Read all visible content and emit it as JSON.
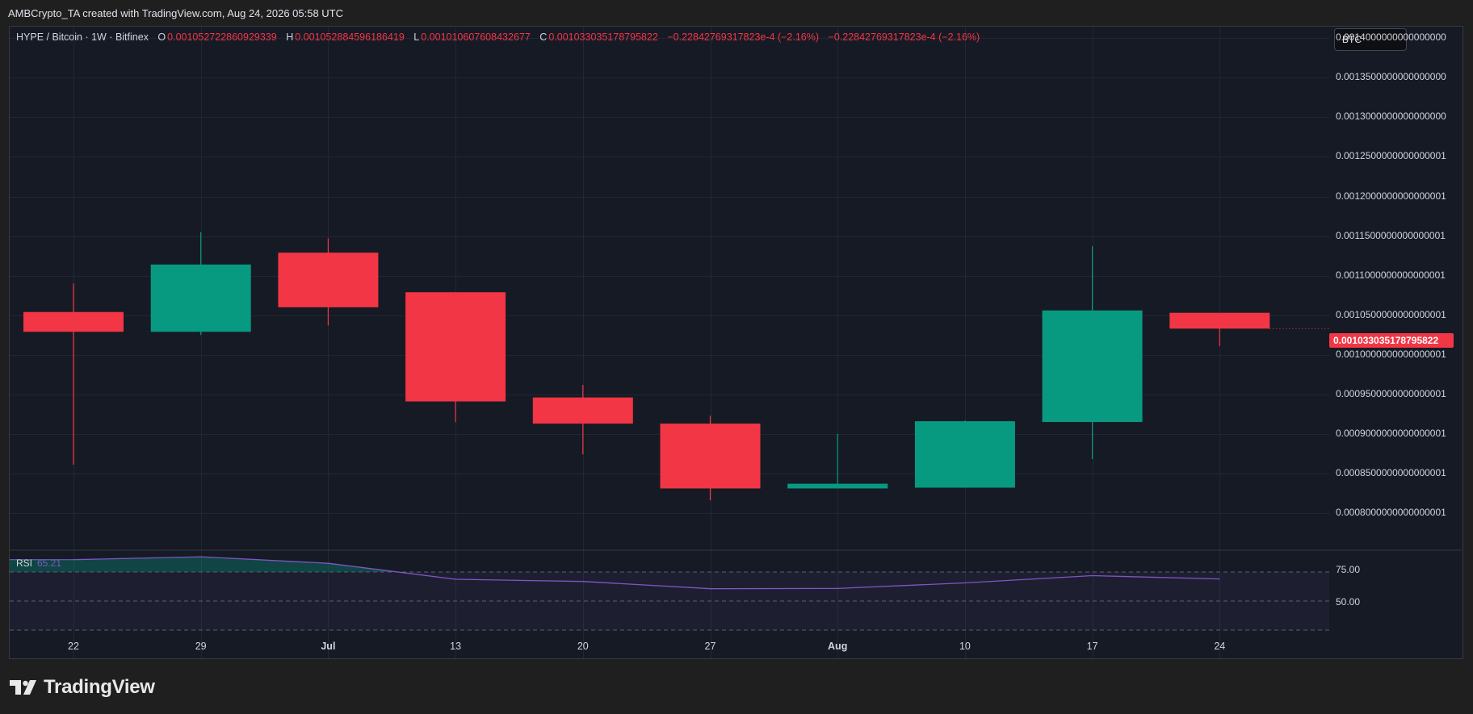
{
  "header": {
    "attribution": "AMBCrypto_TA created with TradingView.com, Aug 24, 2026 05:58 UTC"
  },
  "legend": {
    "symbol": "HYPE / Bitcoin · 1W · Bitfinex",
    "o_key": "O",
    "o_val": "0.001052722860929339",
    "h_key": "H",
    "h_val": "0.001052884596186419",
    "l_key": "L",
    "l_val": "0.001010607608432677",
    "c_key": "C",
    "c_val": "0.001033035178795822",
    "change1": "−0.22842769317823e-4 (−2.16%)",
    "change2": "−0.22842769317823e-4 (−2.16%)"
  },
  "currency_badge": "BTC",
  "last_price_tag": "0.001033035178795822",
  "rsi": {
    "label": "RSI",
    "value": "65.21",
    "ticks": [
      "75.00",
      "50.00"
    ]
  },
  "brand": "TradingView",
  "colors": {
    "up": "#089981",
    "down": "#f23645",
    "rsi": "#7e57c2",
    "background": "#161a25"
  },
  "chart_data": {
    "type": "candlestick",
    "title": "HYPE / Bitcoin · 1W · Bitfinex",
    "price_axis_labels": [
      "0.0014000000000000000",
      "0.0013500000000000000",
      "0.0013000000000000000",
      "0.0012500000000000001",
      "0.0012000000000000001",
      "0.0011500000000000001",
      "0.0011000000000000001",
      "0.0010500000000000001",
      "0.0010000000000000001",
      "0.0009500000000000001",
      "0.0009000000000000001",
      "0.0008500000000000001",
      "0.0008000000000000001"
    ],
    "price_axis_values": [
      0.0014,
      0.00135,
      0.0013,
      0.00125,
      0.0012,
      0.00115,
      0.0011,
      0.00105,
      0.001,
      0.00095,
      0.0009,
      0.00085,
      0.0008
    ],
    "ylim": [
      0.000755,
      0.0014075
    ],
    "x_labels": [
      "22",
      "29",
      "Jul",
      "13",
      "20",
      "27",
      "Aug",
      "10",
      "17",
      "24"
    ],
    "x_labels_bold": [
      "Jul",
      "Aug"
    ],
    "candles": [
      {
        "date": "22",
        "open": 0.001054,
        "high": 0.00109,
        "low": 0.000861,
        "close": 0.001029
      },
      {
        "date": "29",
        "open": 0.001029,
        "high": 0.001155,
        "low": 0.001025,
        "close": 0.001114
      },
      {
        "date": "Jul",
        "open": 0.001129,
        "high": 0.001147,
        "low": 0.001037,
        "close": 0.00106
      },
      {
        "date": "13",
        "open": 0.001079,
        "high": 0.001079,
        "low": 0.000915,
        "close": 0.000941
      },
      {
        "date": "20",
        "open": 0.000946,
        "high": 0.000962,
        "low": 0.000874,
        "close": 0.000913
      },
      {
        "date": "27",
        "open": 0.000913,
        "high": 0.000923,
        "low": 0.000816,
        "close": 0.000831
      },
      {
        "date": "Aug",
        "open": 0.000831,
        "high": 0.0009,
        "low": 0.000831,
        "close": 0.000837
      },
      {
        "date": "10",
        "open": 0.000832,
        "high": 0.000917,
        "low": 0.000832,
        "close": 0.000916
      },
      {
        "date": "17",
        "open": 0.000915,
        "high": 0.001137,
        "low": 0.000868,
        "close": 0.001056
      },
      {
        "date": "24",
        "open": 0.001053,
        "high": 0.001053,
        "low": 0.001011,
        "close": 0.001033
      }
    ],
    "rsi_series": [
      78.5,
      80.5,
      76,
      65,
      63.5,
      58.5,
      58.7,
      62.5,
      67.5,
      65.2
    ],
    "rsi_range": [
      25,
      85
    ],
    "rsi_bands": [
      70,
      50,
      30
    ]
  }
}
